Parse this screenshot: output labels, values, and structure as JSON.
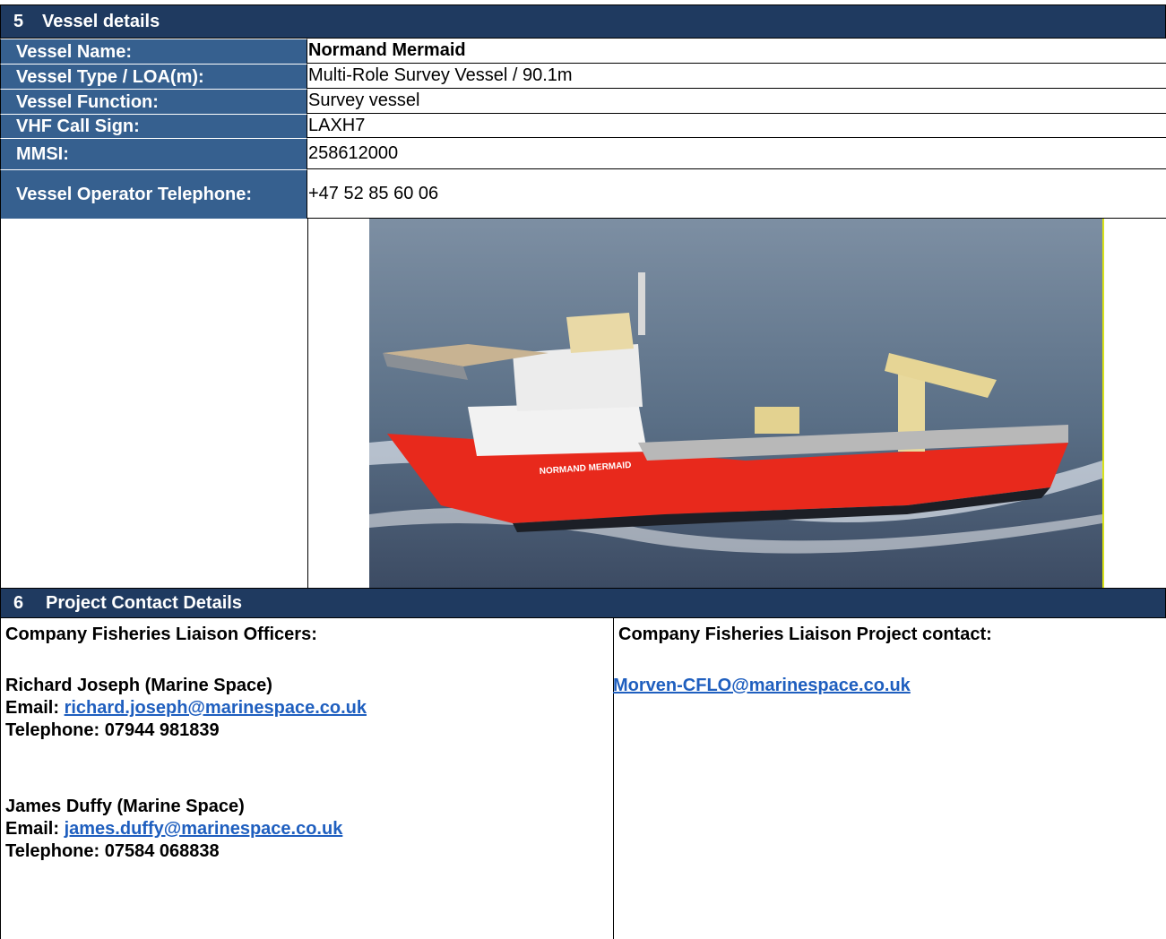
{
  "section5": {
    "number": "5",
    "title": "Vessel details",
    "rows": [
      {
        "label": "Vessel Name:",
        "value": "Normand Mermaid"
      },
      {
        "label": "Vessel Type / LOA(m):",
        "value": "Multi-Role Survey Vessel / 90.1m"
      },
      {
        "label": "Vessel Function:",
        "value": "Survey vessel"
      },
      {
        "label": "VHF Call Sign:",
        "value": "LAXH7"
      },
      {
        "label": "MMSI:",
        "value": "258612000"
      },
      {
        "label": "Vessel Operator Telephone:",
        "value": "+47 52 85 60 06"
      }
    ],
    "photo": {
      "hull_name": "NORMAND MERMAID",
      "hull_color": "#e8291c",
      "sea_color": "#5a6f86"
    }
  },
  "section6": {
    "number": "6",
    "title": "Project Contact Details",
    "left": {
      "heading": "Company Fisheries Liaison Officers:",
      "contacts": [
        {
          "name": "Richard Joseph (Marine Space)",
          "email_label": "Email:",
          "email": "richard.joseph@marinespace.co.uk",
          "phone": "Telephone: 07944 981839"
        },
        {
          "name": "James Duffy (Marine Space)",
          "email_label": "Email:",
          "email": "james.duffy@marinespace.co.uk",
          "phone": "Telephone: 07584 068838"
        }
      ]
    },
    "right": {
      "heading": "Company Fisheries Liaison Project contact:",
      "email": "Morven-CFLO@marinespace.co.uk"
    }
  },
  "colors": {
    "header": "#1f3a60",
    "label": "#36608f",
    "link": "#1f5fbf"
  }
}
